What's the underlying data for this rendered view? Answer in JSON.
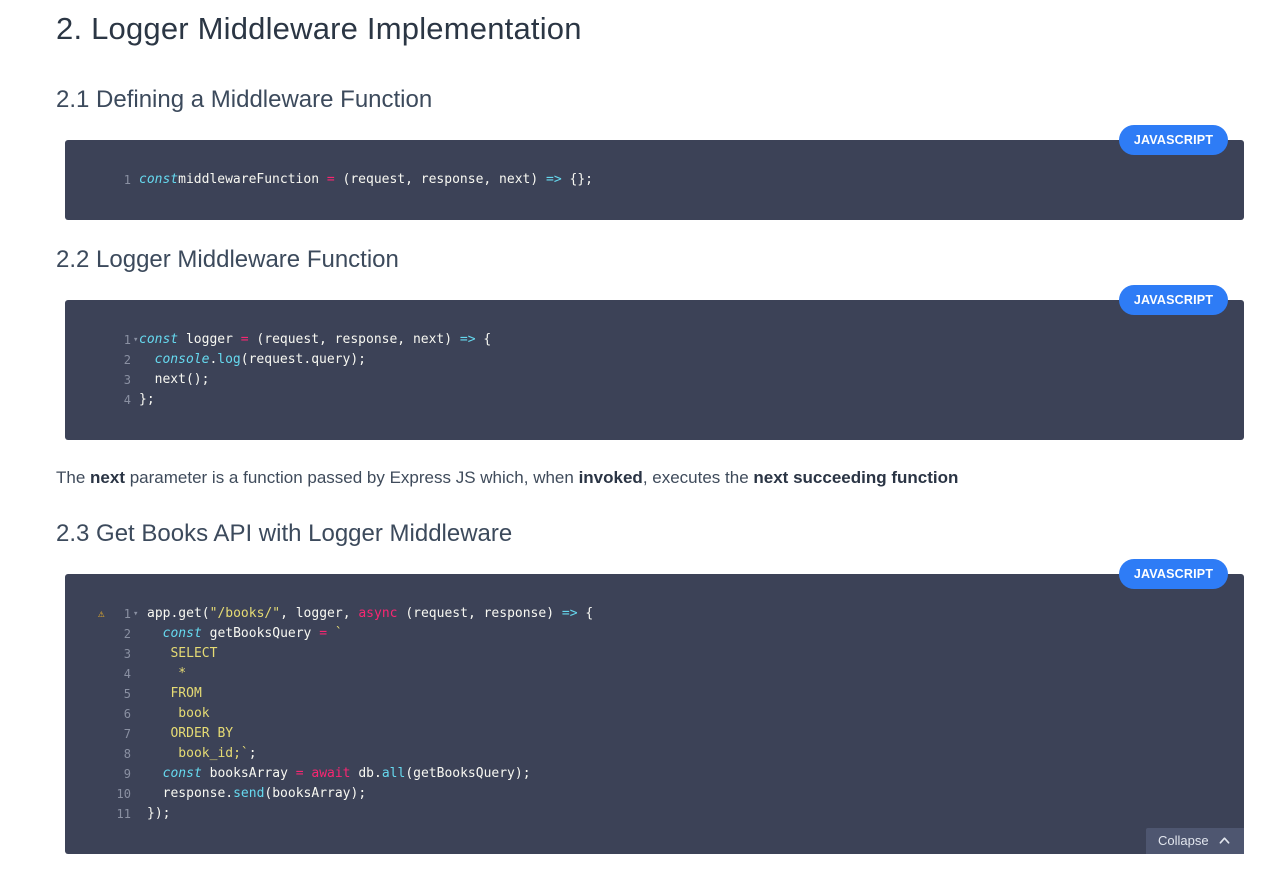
{
  "page": {
    "title": "2. Logger Middleware Implementation"
  },
  "sections": [
    {
      "heading": "2.1 Defining a Middleware Function",
      "language_label": "JAVASCRIPT"
    },
    {
      "heading": "2.2 Logger Middleware Function",
      "language_label": "JAVASCRIPT"
    },
    {
      "heading": "2.3 Get Books API with Logger Middleware",
      "language_label": "JAVASCRIPT",
      "collapse_label": "Collapse"
    }
  ],
  "paragraph": {
    "part1": "The ",
    "bold1": "next",
    "part2": " parameter is a function passed by Express JS which, when ",
    "bold2": "invoked",
    "part3": ", executes the ",
    "bold3": "next succeeding function"
  },
  "code": {
    "block1": [
      {
        "n": "1",
        "fold": "",
        "tokens": [
          [
            "kw-italic",
            "const"
          ],
          [
            "",
            "middlewareFunction "
          ],
          [
            "op",
            "="
          ],
          [
            "",
            " (request, response, next) "
          ],
          [
            "fn-cyan",
            "=>"
          ],
          [
            "",
            " {};"
          ]
        ]
      }
    ],
    "block2": [
      {
        "n": "1",
        "fold": "▾",
        "tokens": [
          [
            "kw-italic",
            "const"
          ],
          [
            "",
            " logger "
          ],
          [
            "op",
            "="
          ],
          [
            "",
            " (request, response, next) "
          ],
          [
            "fn-cyan",
            "=>"
          ],
          [
            "",
            " {"
          ]
        ]
      },
      {
        "n": "2",
        "fold": "",
        "tokens": [
          [
            "",
            "  "
          ],
          [
            "kw-italic",
            "console"
          ],
          [
            "",
            "."
          ],
          [
            "fn-cyan",
            "log"
          ],
          [
            "",
            "(request.query);"
          ]
        ]
      },
      {
        "n": "3",
        "fold": "",
        "tokens": [
          [
            "",
            "  next();"
          ]
        ]
      },
      {
        "n": "4",
        "fold": "",
        "tokens": [
          [
            "",
            "};"
          ]
        ]
      }
    ],
    "block3": [
      {
        "n": "1",
        "fold": "▾",
        "warn": true,
        "tokens": [
          [
            "",
            "app.get("
          ],
          [
            "str",
            "\"/books/\""
          ],
          [
            "",
            ", logger, "
          ],
          [
            "kw-pink",
            "async"
          ],
          [
            "",
            " (request, response) "
          ],
          [
            "fn-cyan",
            "=>"
          ],
          [
            "",
            " {"
          ]
        ]
      },
      {
        "n": "2",
        "fold": "",
        "tokens": [
          [
            "",
            "  "
          ],
          [
            "kw-italic",
            "const"
          ],
          [
            "",
            " getBooksQuery "
          ],
          [
            "op",
            "="
          ],
          [
            "",
            " "
          ],
          [
            "str",
            "`"
          ]
        ]
      },
      {
        "n": "3",
        "fold": "",
        "tokens": [
          [
            "str",
            "   SELECT"
          ]
        ]
      },
      {
        "n": "4",
        "fold": "",
        "tokens": [
          [
            "str",
            "    *"
          ]
        ]
      },
      {
        "n": "5",
        "fold": "",
        "tokens": [
          [
            "str",
            "   FROM"
          ]
        ]
      },
      {
        "n": "6",
        "fold": "",
        "tokens": [
          [
            "str",
            "    book"
          ]
        ]
      },
      {
        "n": "7",
        "fold": "",
        "tokens": [
          [
            "str",
            "   ORDER BY"
          ]
        ]
      },
      {
        "n": "8",
        "fold": "",
        "tokens": [
          [
            "str",
            "    book_id;`"
          ],
          [
            "",
            ";"
          ]
        ]
      },
      {
        "n": "9",
        "fold": "",
        "tokens": [
          [
            "",
            "  "
          ],
          [
            "kw-italic",
            "const"
          ],
          [
            "",
            " booksArray "
          ],
          [
            "op",
            "="
          ],
          [
            "",
            " "
          ],
          [
            "kw-pink",
            "await"
          ],
          [
            "",
            " db."
          ],
          [
            "fn-cyan",
            "all"
          ],
          [
            "",
            "(getBooksQuery);"
          ]
        ]
      },
      {
        "n": "10",
        "fold": "",
        "tokens": [
          [
            "",
            "  response."
          ],
          [
            "fn-cyan",
            "send"
          ],
          [
            "",
            "(booksArray);"
          ]
        ]
      },
      {
        "n": "11",
        "fold": "",
        "tokens": [
          [
            "",
            "});"
          ]
        ]
      }
    ]
  },
  "icons": {
    "warning": "warning-icon",
    "collapse": "chevron-up-icon",
    "fold": "fold-arrow-icon"
  },
  "colors": {
    "code_bg": "#3c4257",
    "badge_bg": "#2e7cf6",
    "keyword": "#66d9ef",
    "operator": "#f92672",
    "string": "#e6db74"
  }
}
